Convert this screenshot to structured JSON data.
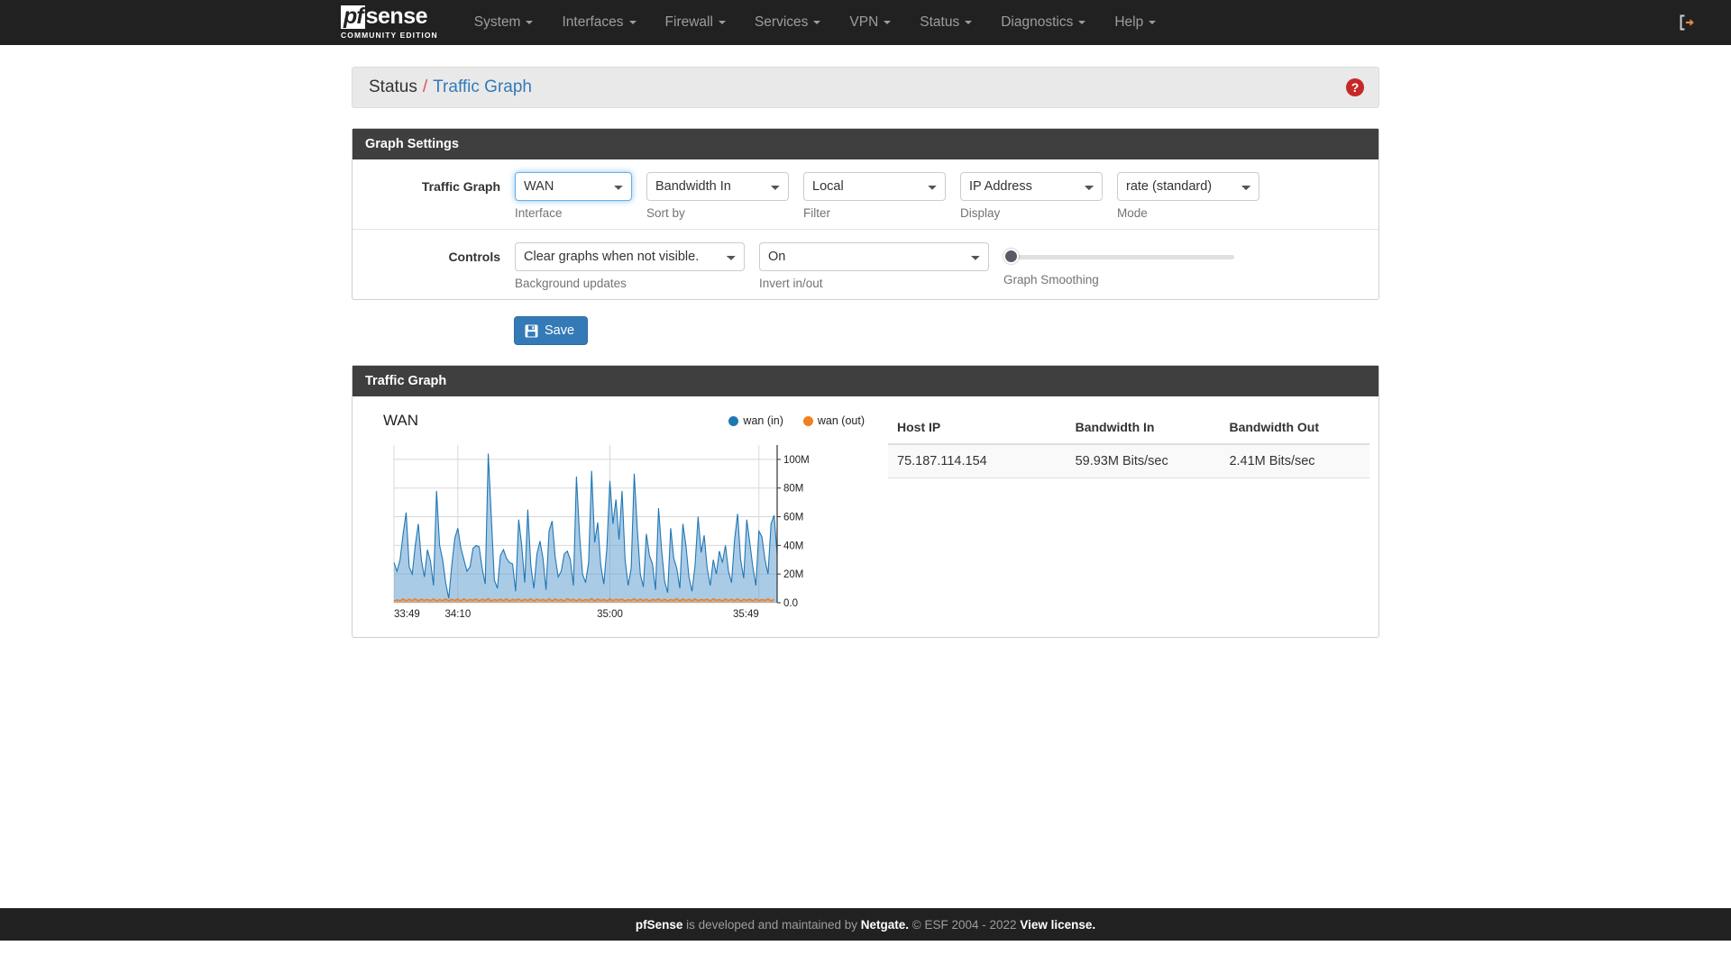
{
  "navbar": {
    "brand": {
      "pf": "pf",
      "sense": "sense",
      "edition": "COMMUNITY EDITION"
    },
    "items": [
      {
        "label": "System"
      },
      {
        "label": "Interfaces"
      },
      {
        "label": "Firewall"
      },
      {
        "label": "Services"
      },
      {
        "label": "VPN"
      },
      {
        "label": "Status"
      },
      {
        "label": "Diagnostics"
      },
      {
        "label": "Help"
      }
    ],
    "logout_icon": "sign-out-icon"
  },
  "breadcrumb": {
    "root": "Status",
    "separator": "/",
    "current": "Traffic Graph",
    "help_icon": "question-mark-icon"
  },
  "graph_settings": {
    "heading": "Graph Settings",
    "rows": [
      {
        "label": "Traffic Graph",
        "fields": [
          {
            "value": "WAN",
            "help": "Interface",
            "focused": true,
            "name": "interface-select"
          },
          {
            "value": "Bandwidth In",
            "help": "Sort by",
            "focused": false,
            "name": "sort-by-select"
          },
          {
            "value": "Local",
            "help": "Filter",
            "focused": false,
            "name": "filter-select"
          },
          {
            "value": "IP Address",
            "help": "Display",
            "focused": false,
            "name": "display-select"
          },
          {
            "value": "rate (standard)",
            "help": "Mode",
            "focused": false,
            "name": "mode-select"
          }
        ]
      },
      {
        "label": "Controls",
        "fields": [
          {
            "value": "Clear graphs when not visible.",
            "help": "Background updates",
            "focused": false,
            "name": "background-updates-select"
          },
          {
            "value": "On",
            "help": "Invert in/out",
            "focused": false,
            "name": "invert-in-out-select"
          }
        ],
        "slider": {
          "help": "Graph Smoothing",
          "value": 0
        }
      }
    ],
    "save_label": "Save",
    "save_icon": "floppy-disk-icon"
  },
  "traffic_graph": {
    "heading": "Traffic Graph",
    "table": {
      "columns": [
        "Host IP",
        "Bandwidth In",
        "Bandwidth Out"
      ],
      "rows": [
        [
          "75.187.114.154",
          "59.93M Bits/sec",
          "2.41M Bits/sec"
        ]
      ]
    }
  },
  "footer": {
    "product": "pfSense",
    "mid": " is developed and maintained by ",
    "company": "Netgate.",
    "copyright": " © ESF 2004 - 2022 ",
    "license": "View license."
  },
  "chart_data": {
    "type": "area",
    "title": "WAN",
    "xlabel": "",
    "ylabel": "",
    "ylim": [
      0,
      110000000
    ],
    "yticks": [
      0,
      20000000,
      40000000,
      60000000,
      80000000,
      100000000
    ],
    "ytick_labels": [
      "0.0",
      "20M",
      "40M",
      "60M",
      "80M",
      "100M"
    ],
    "xticks": [
      0,
      21,
      71,
      120
    ],
    "xtick_labels": [
      "33:49",
      "34:10",
      "35:00",
      "35:49"
    ],
    "grid": true,
    "legend_position": "top-right",
    "colors": {
      "in": "#1f77b4",
      "out": "#f08022"
    },
    "series": [
      {
        "name": "wan (in)",
        "color": "#1f77b4",
        "fill": "rgba(100,160,210,0.55)",
        "values": [
          28,
          22,
          30,
          48,
          63,
          25,
          20,
          40,
          55,
          30,
          18,
          37,
          29,
          12,
          78,
          40,
          30,
          14,
          3,
          26,
          45,
          52,
          38,
          30,
          22,
          25,
          38,
          40,
          39,
          24,
          13,
          104,
          60,
          16,
          10,
          33,
          37,
          31,
          28,
          27,
          8,
          58,
          40,
          14,
          65,
          26,
          10,
          34,
          43,
          31,
          9,
          50,
          57,
          32,
          18,
          22,
          34,
          36,
          30,
          12,
          88,
          48,
          20,
          14,
          28,
          92,
          42,
          56,
          26,
          13,
          38,
          85,
          55,
          72,
          44,
          78,
          30,
          12,
          24,
          90,
          52,
          20,
          11,
          48,
          33,
          27,
          9,
          66,
          37,
          15,
          7,
          52,
          31,
          24,
          10,
          55,
          40,
          18,
          8,
          26,
          60,
          35,
          47,
          24,
          12,
          30,
          20,
          36,
          28,
          40,
          22,
          14,
          44,
          62,
          30,
          17,
          58,
          42,
          25,
          12,
          50,
          46,
          30,
          20,
          55,
          61,
          34
        ]
      },
      {
        "name": "wan (out)",
        "color": "#f08022",
        "values": [
          1.2,
          2.0,
          1.4,
          2.6,
          1.3,
          2.4,
          1.5,
          2.8,
          1.2,
          2.5,
          1.6,
          2.3,
          1.4,
          2.7,
          1.3,
          2.2,
          1.5,
          2.6,
          1.2,
          2.4,
          1.6,
          2.5,
          1.3,
          2.8,
          1.4,
          2.3,
          1.7,
          2.6,
          1.2,
          2.4,
          1.5,
          2.9,
          1.3,
          2.2,
          1.6,
          2.5,
          1.4,
          2.7,
          1.2,
          2.3,
          1.8,
          2.6,
          1.3,
          2.4,
          1.5,
          2.8,
          1.2,
          2.5,
          1.6,
          2.2,
          1.4,
          2.7,
          1.3,
          2.6,
          1.5,
          2.3,
          1.2,
          2.8,
          1.7,
          2.4,
          1.3,
          2.5,
          1.4,
          2.2,
          1.6,
          2.9,
          1.2,
          2.6,
          1.5,
          2.3,
          1.3,
          2.7,
          1.4,
          2.4,
          1.8,
          2.5,
          1.2,
          2.2,
          1.6,
          2.8,
          1.3,
          2.6,
          1.5,
          2.4,
          1.2,
          2.3,
          1.7,
          2.7,
          1.4,
          2.5,
          1.3,
          2.2,
          1.6,
          2.9,
          1.2,
          2.6,
          1.5,
          2.4,
          1.3,
          2.8,
          1.4,
          2.3,
          1.7,
          2.5,
          1.2,
          2.7,
          1.6,
          2.2,
          1.3,
          2.6,
          1.5,
          2.4,
          1.4,
          2.8,
          1.2,
          2.3,
          1.7,
          2.5,
          1.3,
          2.6,
          1.5,
          2.2,
          1.6,
          2.7,
          1.3,
          2.4
        ]
      }
    ]
  }
}
